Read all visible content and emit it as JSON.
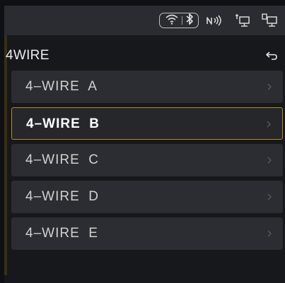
{
  "statusbar": {
    "icons": [
      "wifi-icon",
      "bluetooth-icon",
      "nfc-icon",
      "pc-link-icon",
      "pc-connected-icon"
    ]
  },
  "header": {
    "title": "4WIRE",
    "back_icon": "back-arrow-icon"
  },
  "list": {
    "items": [
      {
        "label": "4–WIRE  A",
        "selected": false
      },
      {
        "label": "4–WIRE  B",
        "selected": true
      },
      {
        "label": "4–WIRE  C",
        "selected": false
      },
      {
        "label": "4–WIRE  D",
        "selected": false
      },
      {
        "label": "4–WIRE  E",
        "selected": false
      }
    ]
  },
  "colors": {
    "background": "#17181b",
    "statusbar": "#2a2c31",
    "item": "#2b2d32",
    "selected_border": "#b58a2a"
  }
}
